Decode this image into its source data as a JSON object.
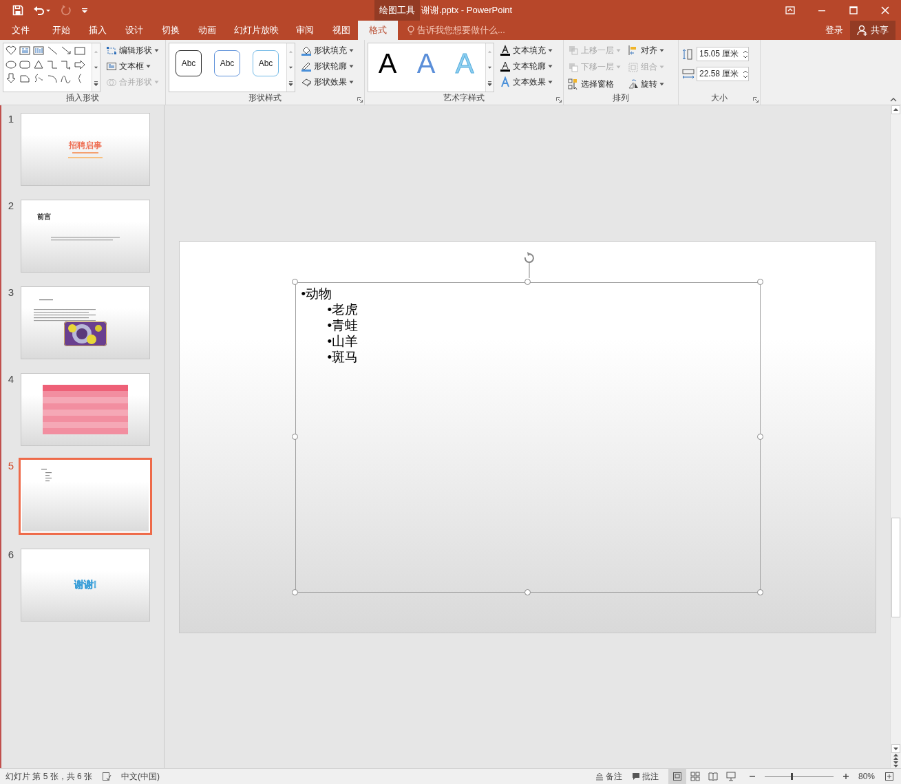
{
  "title_bar": {
    "context_label": "绘图工具",
    "title": "谢谢.pptx - PowerPoint"
  },
  "tabs": [
    {
      "label": "文件",
      "selected": false
    },
    {
      "label": "开始",
      "selected": false
    },
    {
      "label": "插入",
      "selected": false
    },
    {
      "label": "设计",
      "selected": false
    },
    {
      "label": "切换",
      "selected": false
    },
    {
      "label": "动画",
      "selected": false
    },
    {
      "label": "幻灯片放映",
      "selected": false
    },
    {
      "label": "审阅",
      "selected": false
    },
    {
      "label": "视图",
      "selected": false
    },
    {
      "label": "格式",
      "selected": true
    }
  ],
  "tell_me": {
    "placeholder": "告诉我您想要做什么..."
  },
  "account": {
    "sign_in": "登录",
    "share": "共享"
  },
  "ribbon": {
    "insert_shapes": {
      "title": "插入形状",
      "commands": [
        {
          "label": "编辑形状",
          "disabled": false
        },
        {
          "label": "文本框",
          "disabled": false
        },
        {
          "label": "合并形状",
          "disabled": true
        }
      ]
    },
    "shape_styles": {
      "title": "形状样式",
      "presets": [
        {
          "label": "Abc",
          "color": "#262626"
        },
        {
          "label": "Abc",
          "color": "#5b8fd9"
        },
        {
          "label": "Abc",
          "color": "#6fb8e6"
        }
      ],
      "commands": [
        {
          "label": "形状填充"
        },
        {
          "label": "形状轮廓"
        },
        {
          "label": "形状效果"
        }
      ]
    },
    "wordart_styles": {
      "title": "艺术字样式",
      "presets": [
        {
          "label": "A",
          "color": "#000000"
        },
        {
          "label": "A",
          "color": "#5b8fd9"
        },
        {
          "label": "A",
          "color": "#8fd0f0"
        }
      ],
      "commands": [
        {
          "label": "文本填充"
        },
        {
          "label": "文本轮廓"
        },
        {
          "label": "文本效果"
        }
      ]
    },
    "arrange": {
      "title": "排列",
      "commands": [
        {
          "label": "上移一层",
          "disabled": true
        },
        {
          "label": "对齐",
          "disabled": false
        },
        {
          "label": "下移一层",
          "disabled": true
        },
        {
          "label": "组合",
          "disabled": true
        },
        {
          "label": "选择窗格",
          "disabled": false
        },
        {
          "label": "旋转",
          "disabled": false
        }
      ]
    },
    "size": {
      "title": "大小",
      "height": "15.05 厘米",
      "width": "22.58 厘米"
    }
  },
  "slides": [
    {
      "number": "1",
      "kind": "title",
      "title": "招聘启事",
      "selected": false
    },
    {
      "number": "2",
      "kind": "heading",
      "title": "前言",
      "selected": false
    },
    {
      "number": "3",
      "kind": "text-picture",
      "selected": false
    },
    {
      "number": "4",
      "kind": "table",
      "selected": false
    },
    {
      "number": "5",
      "kind": "bullets",
      "selected": true
    },
    {
      "number": "6",
      "kind": "wordart",
      "title": "谢谢!",
      "selected": false
    }
  ],
  "slide_content": {
    "items": [
      {
        "text": "•动物",
        "children": [
          {
            "text": "•老虎"
          },
          {
            "text": "•青蛙"
          },
          {
            "text": "•山羊"
          },
          {
            "text": "•斑马"
          }
        ]
      }
    ]
  },
  "status_bar": {
    "slide_info": "幻灯片 第 5 张，共 6 张",
    "language": "中文(中国)",
    "notes": "备注",
    "comments": "批注",
    "zoom": "80%",
    "zoom_slider": {
      "level": 0.4
    }
  }
}
